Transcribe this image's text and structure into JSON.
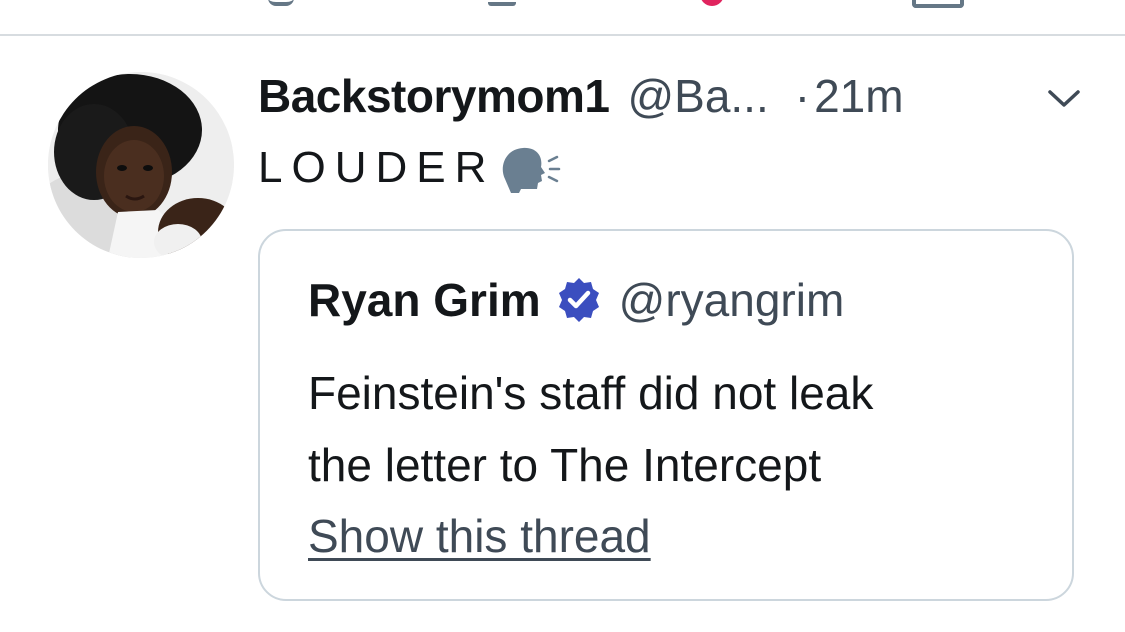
{
  "tweet": {
    "display_name": "Backstorymom1",
    "handle": "@Ba...",
    "dot": "·",
    "timestamp": "21m",
    "text": "LOUDER",
    "emoji_icon": "speaking-head-icon",
    "menu_icon": "chevron-down-icon"
  },
  "quote": {
    "display_name": "Ryan Grim",
    "verified_icon": "verified-badge-icon",
    "handle": "@ryangrim",
    "body_line_1": "Feinstein's staff did not leak",
    "body_line_2": "the letter to The Intercept",
    "show_thread": "Show this thread"
  },
  "colors": {
    "text_primary": "#14171a",
    "text_secondary": "#3f4a56",
    "verified": "#3b4ebf",
    "card_border": "#ccd6dd",
    "divider": "#d7dce0",
    "like_red": "#e0245e"
  }
}
